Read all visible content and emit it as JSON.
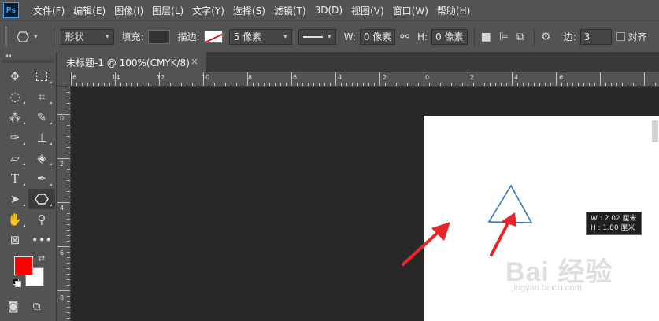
{
  "app": {
    "logo": "Ps"
  },
  "menu": [
    "文件(F)",
    "编辑(E)",
    "图像(I)",
    "图层(L)",
    "文字(Y)",
    "选择(S)",
    "滤镜(T)",
    "3D(D)",
    "视图(V)",
    "窗口(W)",
    "帮助(H)"
  ],
  "options": {
    "tool_preset_icon": "polygon-icon",
    "mode": "形状",
    "fill_label": "填充:",
    "fill_color": "#323232",
    "stroke_label": "描边:",
    "stroke_color": "none (white with red slash)",
    "stroke_size": "5 像素",
    "w_label": "W:",
    "w_value": "0 像素",
    "h_label": "H:",
    "h_value": "0 像素",
    "sides_label": "边:",
    "sides_value": "3",
    "align_label": "对齐"
  },
  "document": {
    "tab_title": "未标题-1 @ 100%(CMYK/8)",
    "tab_close": "×",
    "hruler_ticks": [
      "6",
      "14",
      "12",
      "10",
      "8",
      "6",
      "4",
      "2",
      "0",
      "2",
      "4",
      "6"
    ],
    "vruler_ticks": [
      "0",
      "2",
      "4",
      "6",
      "8"
    ]
  },
  "canvas": {
    "shape": "triangle",
    "shape_stroke": "#2f78b8",
    "tooltip_w": "W : 2.02 厘米",
    "tooltip_h": "H : 1.80 厘米",
    "watermark": "Bai 经验",
    "watermark_sub": "jingyan.baidu.com",
    "arrow_color": "#e8252b"
  },
  "colors": {
    "foreground": "#ff0000",
    "background": "#ffffff"
  },
  "tools": [
    "move-tool-icon",
    "marquee-tool-icon",
    "lasso-tool-icon",
    "crop-tool-icon",
    "magic-wand-tool-icon",
    "eyedropper-tool-icon",
    "brush-tool-icon",
    "stamp-tool-icon",
    "eraser-tool-icon",
    "paint-bucket-tool-icon",
    "type-tool-icon",
    "pen-tool-icon",
    "path-selection-tool-icon",
    "polygon-tool-icon",
    "hand-tool-icon",
    "zoom-tool-icon",
    "frame-tool-icon",
    "more-tools-icon"
  ]
}
